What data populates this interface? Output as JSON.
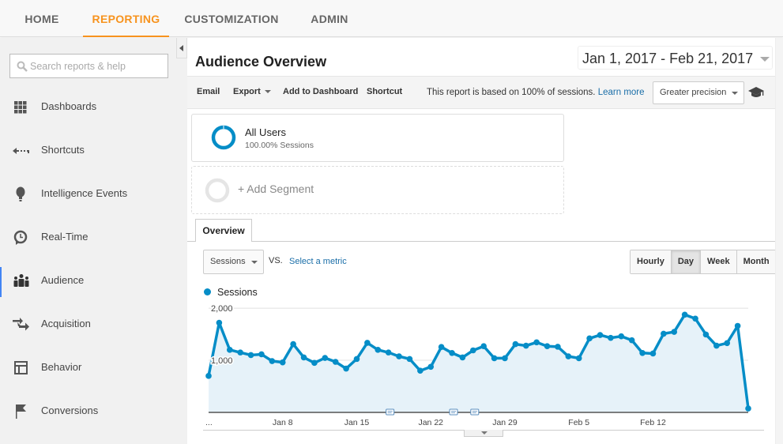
{
  "topnav": {
    "tabs": [
      {
        "label": "HOME",
        "active": false
      },
      {
        "label": "REPORTING",
        "active": true
      },
      {
        "label": "CUSTOMIZATION",
        "active": false
      },
      {
        "label": "ADMIN",
        "active": false
      }
    ],
    "accent_color": "#f7931e"
  },
  "sidebar": {
    "search_placeholder": "Search reports & help",
    "items": [
      {
        "label": "Dashboards",
        "icon": "grid-icon"
      },
      {
        "label": "Shortcuts",
        "icon": "shortcut-arrow-icon"
      },
      {
        "label": "Intelligence Events",
        "icon": "lightbulb-icon"
      },
      {
        "label": "Real-Time",
        "icon": "clock-icon"
      },
      {
        "label": "Audience",
        "icon": "people-icon",
        "active": true
      },
      {
        "label": "Acquisition",
        "icon": "arrows-icon"
      },
      {
        "label": "Behavior",
        "icon": "layout-icon"
      },
      {
        "label": "Conversions",
        "icon": "flag-icon"
      }
    ]
  },
  "header": {
    "title": "Audience Overview",
    "date_range": "Jan 1, 2017 - Feb 21, 2017"
  },
  "toolbar": {
    "email": "Email",
    "export": "Export",
    "add_to_dashboard": "Add to Dashboard",
    "shortcut": "Shortcut",
    "note": "This report is based on 100% of sessions.",
    "learn_more": "Learn more",
    "precision": "Greater precision"
  },
  "segments": {
    "active": {
      "name": "All Users",
      "sub": "100.00% Sessions",
      "color": "#058dc7"
    },
    "add_label": "+ Add Segment"
  },
  "tabs": {
    "overview": "Overview"
  },
  "controls": {
    "metric": "Sessions",
    "vs": "VS.",
    "select_metric": "Select a metric",
    "granularity": [
      {
        "label": "Hourly",
        "active": false
      },
      {
        "label": "Day",
        "active": true
      },
      {
        "label": "Week",
        "active": false
      },
      {
        "label": "Month",
        "active": false
      }
    ]
  },
  "legend": {
    "label": "Sessions"
  },
  "chart_data": {
    "type": "area",
    "title": "",
    "xlabel": "",
    "ylabel": "Sessions",
    "series": [
      {
        "name": "Sessions",
        "color": "#058dc7",
        "values": [
          700,
          1720,
          1200,
          1150,
          1100,
          1115,
          985,
          960,
          1310,
          1055,
          950,
          1045,
          970,
          840,
          1025,
          1335,
          1200,
          1150,
          1075,
          1025,
          800,
          875,
          1255,
          1140,
          1055,
          1190,
          1270,
          1040,
          1040,
          1310,
          1280,
          1345,
          1270,
          1260,
          1075,
          1040,
          1420,
          1485,
          1430,
          1460,
          1385,
          1140,
          1130,
          1510,
          1545,
          1875,
          1800,
          1495,
          1280,
          1330,
          1660,
          75
        ]
      }
    ],
    "x_start": "Jan 1, 2017",
    "x_end": "Feb 21, 2017",
    "x_tick_labels": [
      {
        "label": "...",
        "index": 0
      },
      {
        "label": "Jan 8",
        "index": 7
      },
      {
        "label": "Jan 15",
        "index": 14
      },
      {
        "label": "Jan 22",
        "index": 21
      },
      {
        "label": "Jan 29",
        "index": 28
      },
      {
        "label": "Feb 5",
        "index": 35
      },
      {
        "label": "Feb 12",
        "index": 42
      }
    ],
    "y_ticks": [
      {
        "value": 1000,
        "label": "1,000"
      },
      {
        "value": 2000,
        "label": "2,000"
      }
    ],
    "ylim": [
      0,
      2000
    ],
    "grid": true,
    "annotations_at_index": [
      17,
      23,
      25
    ],
    "legend_position": "top-left"
  }
}
